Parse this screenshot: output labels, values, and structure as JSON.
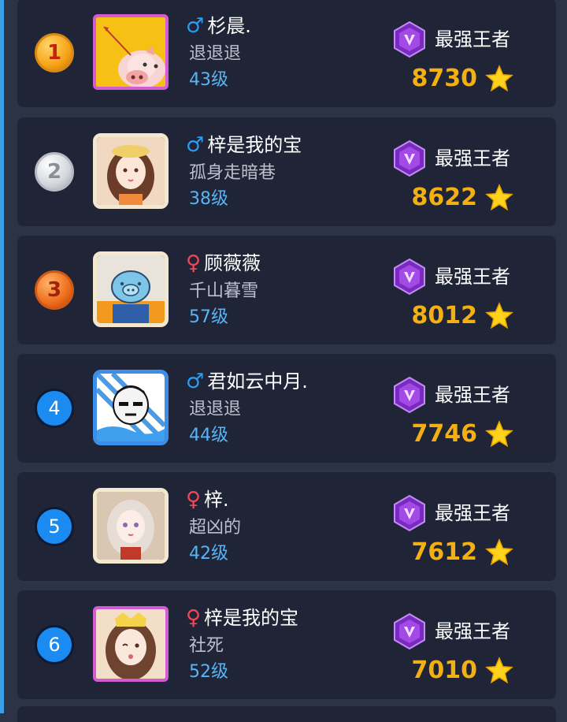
{
  "ranking": {
    "rows": [
      {
        "rank": "1",
        "rank_style": "gold",
        "gender": "male",
        "gender_symbol": "♂",
        "name": "杉晨.",
        "subtitle": "退退退",
        "level": "43级",
        "tier": "最强王者",
        "score": "8730",
        "avatar": "pig-character"
      },
      {
        "rank": "2",
        "rank_style": "silver",
        "gender": "male",
        "gender_symbol": "♂",
        "name": "梓是我的宝",
        "subtitle": "孤身走暗巷",
        "level": "38级",
        "tier": "最强王者",
        "score": "8622",
        "avatar": "anime-girl"
      },
      {
        "rank": "3",
        "rank_style": "bronze",
        "gender": "female",
        "gender_symbol": "♀",
        "name": "顾薇薇",
        "subtitle": "千山暮雪",
        "level": "57级",
        "tier": "最强王者",
        "score": "8012",
        "avatar": "blue-pig"
      },
      {
        "rank": "4",
        "rank_style": "blue",
        "gender": "male",
        "gender_symbol": "♂",
        "name": "君如云中月.",
        "subtitle": "退退退",
        "level": "44级",
        "tier": "最强王者",
        "score": "7746",
        "avatar": "manga-boy"
      },
      {
        "rank": "5",
        "rank_style": "blue",
        "gender": "female",
        "gender_symbol": "♀",
        "name": "梓.",
        "subtitle": "超凶的",
        "level": "42级",
        "tier": "最强王者",
        "score": "7612",
        "avatar": "anime-girl-silver"
      },
      {
        "rank": "6",
        "rank_style": "blue",
        "gender": "female",
        "gender_symbol": "♀",
        "name": "梓是我的宝",
        "subtitle": "社死",
        "level": "52级",
        "tier": "最强王者",
        "score": "7010",
        "avatar": "anime-girl-crown"
      }
    ]
  },
  "colors": {
    "background": "#2c3346",
    "card": "#1f2437",
    "male": "#2c9cf2",
    "female": "#f0475a",
    "level": "#58b4f4",
    "score": "#f4b012",
    "tier_gem": "#9b3fd9"
  },
  "icons": {
    "tier_gem": "purple-gem-icon",
    "score_star": "star-icon",
    "rank_medal": "medal-icon"
  }
}
